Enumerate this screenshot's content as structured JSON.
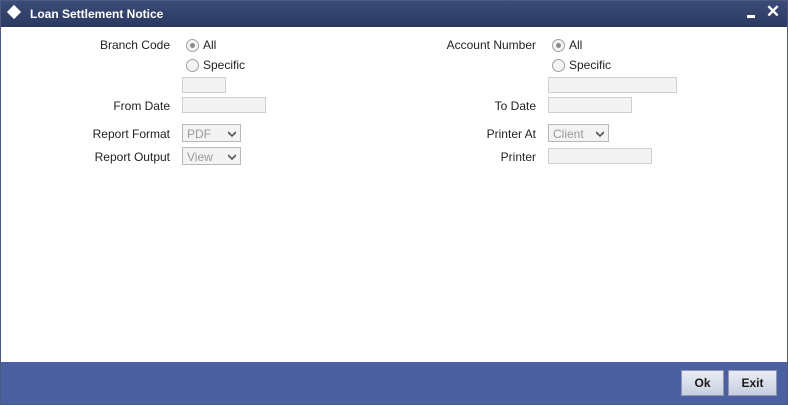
{
  "window": {
    "title": "Loan Settlement Notice",
    "minimize_icon": "minimize-icon",
    "close_icon": "close-icon",
    "close_glyph": "✕"
  },
  "form": {
    "branch_code": {
      "label": "Branch Code",
      "options": [
        "All",
        "Specific"
      ],
      "selected": "All",
      "value": ""
    },
    "account_number": {
      "label": "Account Number",
      "options": [
        "All",
        "Specific"
      ],
      "selected": "All",
      "value": ""
    },
    "from_date": {
      "label": "From Date",
      "value": ""
    },
    "to_date": {
      "label": "To Date",
      "value": ""
    },
    "report_format": {
      "label": "Report Format",
      "value": "PDF"
    },
    "printer_at": {
      "label": "Printer At",
      "value": "Client"
    },
    "report_output": {
      "label": "Report Output",
      "value": "View"
    },
    "printer": {
      "label": "Printer",
      "value": ""
    }
  },
  "footer": {
    "ok_label": "Ok",
    "exit_label": "Exit"
  },
  "colors": {
    "titlebar": "#2f3f6b",
    "footer": "#4a60a0"
  }
}
